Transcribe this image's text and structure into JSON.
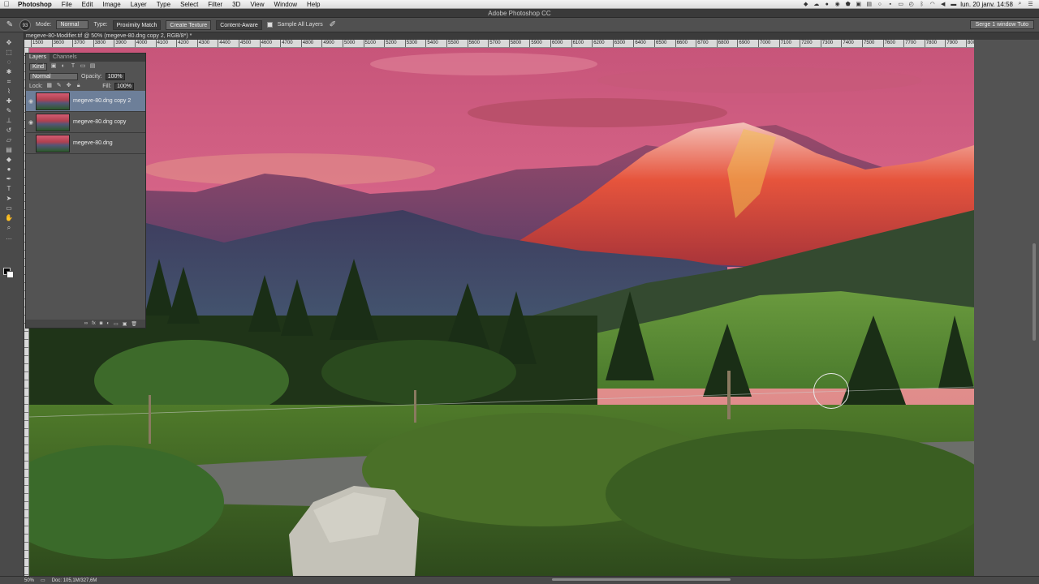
{
  "menubar": {
    "app": "Photoshop",
    "items": [
      "File",
      "Edit",
      "Image",
      "Layer",
      "Type",
      "Select",
      "Filter",
      "3D",
      "View",
      "Window",
      "Help"
    ],
    "clock": "lun. 20 janv. 14:58"
  },
  "window_title": "Adobe Photoshop CC",
  "options": {
    "brush_size": "93",
    "mode_label": "Mode:",
    "mode_value": "Normal",
    "type_label": "Type:",
    "type_options": [
      "Proximity Match",
      "Create Texture",
      "Content-Aware"
    ],
    "sample_all_layers": "Sample All Layers",
    "workspace": "Serge 1 window Tuto"
  },
  "document": {
    "tab_title": "megeve-80-Modifier.tif @ 50% (megeve-80.dng copy 2, RGB/8*) *"
  },
  "ruler_labels": [
    "1500",
    "3600",
    "3700",
    "3800",
    "3900",
    "4000",
    "4100",
    "4200",
    "4300",
    "4400",
    "4500",
    "4600",
    "4700",
    "4800",
    "4900",
    "5000",
    "5100",
    "5200",
    "5300",
    "5400",
    "5500",
    "5600",
    "5700",
    "5800",
    "5900",
    "6000",
    "6100",
    "6200",
    "6300",
    "6400",
    "6500",
    "6600",
    "6700",
    "6800",
    "6900",
    "7000",
    "7100",
    "7200",
    "7300",
    "7400",
    "7500",
    "7600",
    "7700",
    "7800",
    "7900",
    "8000",
    "8100"
  ],
  "layers_panel": {
    "tabs": [
      "Layers",
      "Channels"
    ],
    "filter_kind": "Kind",
    "blend_mode": "Normal",
    "opacity_label": "Opacity:",
    "opacity_value": "100%",
    "lock_label": "Lock:",
    "fill_label": "Fill:",
    "fill_value": "100%",
    "layers": [
      {
        "name": "megeve-80.dng copy 2"
      },
      {
        "name": "megeve-80.dng copy"
      },
      {
        "name": "megeve-80.dng"
      }
    ]
  },
  "status": {
    "zoom": "50%",
    "doc_info": "Doc: 105,1M/327,6M"
  },
  "colors": {
    "ui_dark": "#535353",
    "selection": "#6d7f99"
  }
}
